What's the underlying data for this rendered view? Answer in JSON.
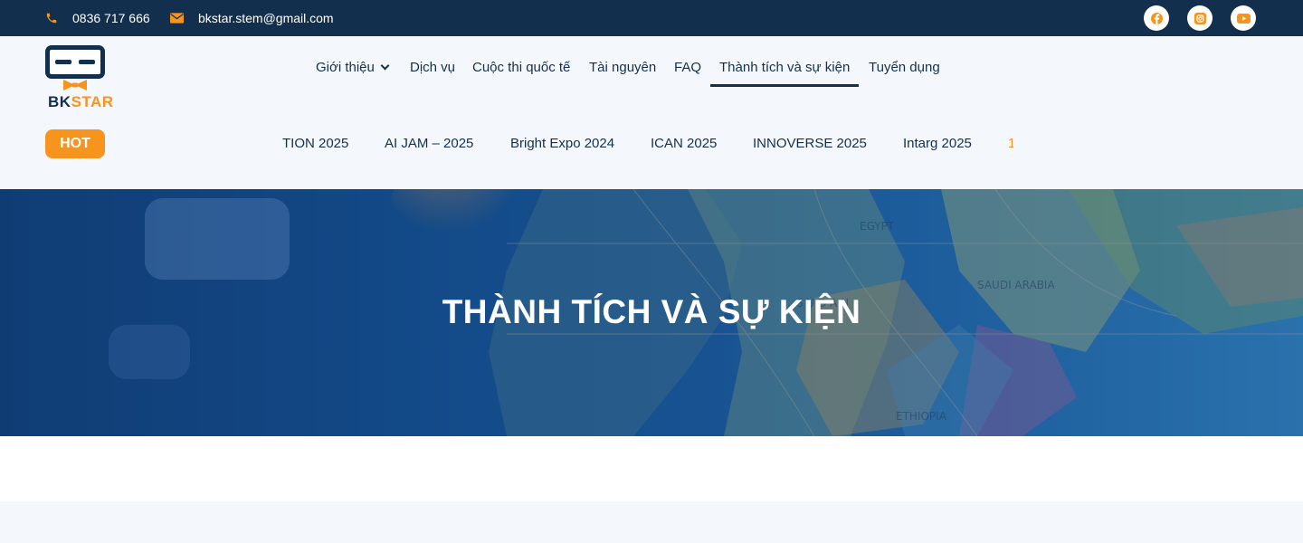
{
  "topbar": {
    "phone": "0836 717 666",
    "email": "bkstar.stem@gmail.com",
    "social": [
      "facebook-icon",
      "instagram-icon",
      "youtube-icon"
    ]
  },
  "logo": {
    "text_bk": "BK",
    "text_star": "STAR"
  },
  "nav": {
    "items": [
      {
        "label": "Giới thiệu",
        "has_dropdown": true
      },
      {
        "label": "Dịch vụ"
      },
      {
        "label": "Cuộc thi quốc tế"
      },
      {
        "label": "Tài nguyên"
      },
      {
        "label": "FAQ"
      },
      {
        "label": "Thành tích và sự kiện",
        "active": true
      },
      {
        "label": "Tuyển dụng"
      }
    ]
  },
  "ticker": {
    "badge": "HOT",
    "items": [
      "TION 2025",
      "AI JAM – 2025",
      "Bright Expo 2024",
      "ICAN 2025",
      "INNOVERSE 2025",
      "Intarg 2025",
      "1"
    ]
  },
  "hero": {
    "title": "THÀNH TÍCH VÀ SỰ KIỆN"
  },
  "colors": {
    "navy": "#12304d",
    "orange": "#f7941d",
    "background": "#f4f7fb"
  }
}
